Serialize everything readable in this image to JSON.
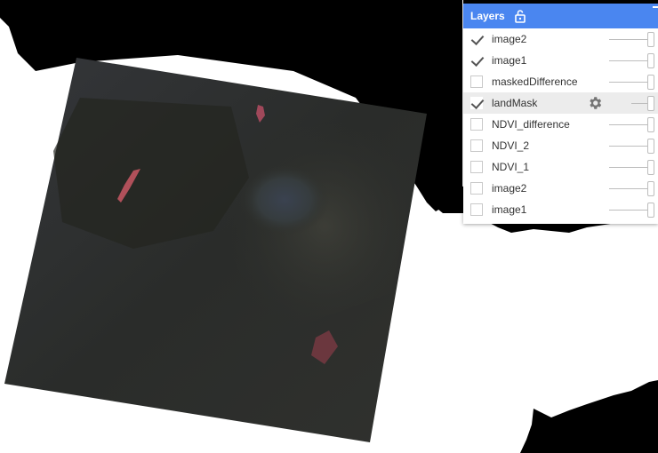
{
  "panel": {
    "title": "Layers",
    "lock_icon": "lock-open-icon",
    "collapse_icon": "collapse-icon",
    "accent_color": "#4a86f0"
  },
  "layers": [
    {
      "label": "image2",
      "checked": true
    },
    {
      "label": "image1",
      "checked": true
    },
    {
      "label": "maskedDifference",
      "checked": false
    },
    {
      "label": "landMask",
      "checked": true,
      "hovered": true,
      "settings_icon": "gear-icon"
    },
    {
      "label": "NDVI_difference",
      "checked": false
    },
    {
      "label": "NDVI_2",
      "checked": false
    },
    {
      "label": "NDVI_1",
      "checked": false
    },
    {
      "label": "image2",
      "checked": false
    },
    {
      "label": "image1",
      "checked": false
    }
  ],
  "map": {
    "land_color": "#000000",
    "water_color": "#ffffff",
    "image_color": "#2e302c"
  }
}
